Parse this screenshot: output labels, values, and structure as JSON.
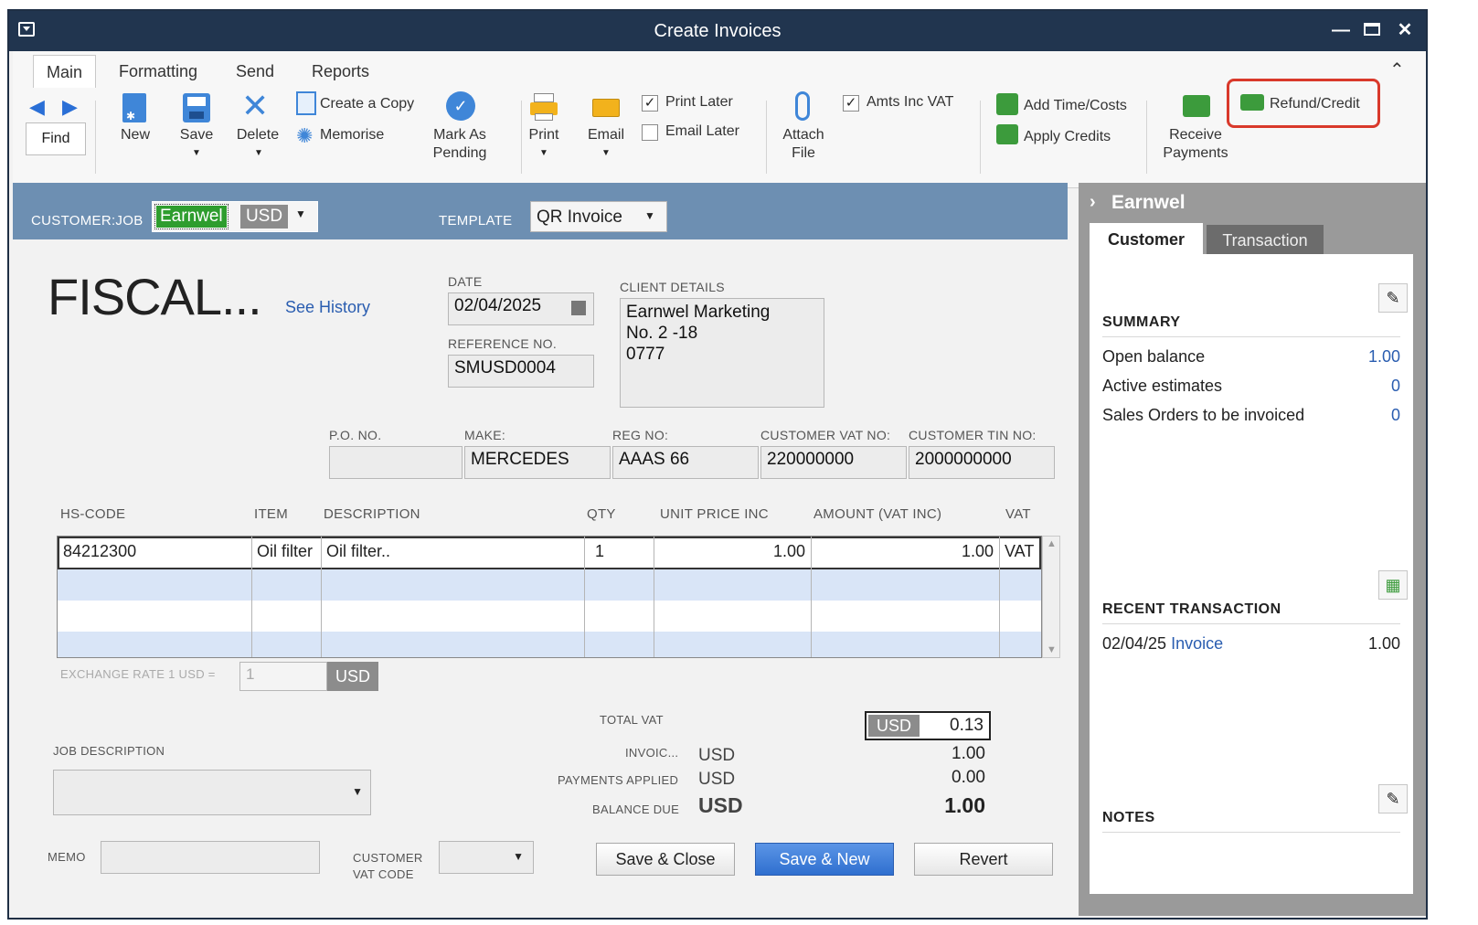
{
  "window": {
    "title": "Create Invoices"
  },
  "ribbon": {
    "tabs": [
      "Main",
      "Formatting",
      "Send",
      "Reports"
    ],
    "find_label": "Find",
    "new_label": "New",
    "save_label": "Save",
    "delete_label": "Delete",
    "create_copy_label": "Create a Copy",
    "memorise_label": "Memorise",
    "mark_as_pending_label": "Mark As\nPending",
    "print_label": "Print",
    "email_label": "Email",
    "print_later_label": "Print Later",
    "print_later_checked": true,
    "email_later_label": "Email Later",
    "email_later_checked": false,
    "attach_file_label": "Attach\nFile",
    "amts_inc_vat_label": "Amts Inc VAT",
    "amts_inc_vat_checked": true,
    "add_time_costs_label": "Add Time/Costs",
    "apply_credits_label": "Apply Credits",
    "receive_payments_label": "Receive\nPayments",
    "refund_credit_label": "Refund/Credit"
  },
  "header": {
    "customer_job_label": "CUSTOMER:JOB",
    "customer_job_value": "Earnwel",
    "currency": "USD",
    "template_label": "TEMPLATE",
    "template_value": "QR Invoice"
  },
  "form": {
    "title": "FISCAL...",
    "see_history": "See History",
    "date_label": "DATE",
    "date_value": "02/04/2025",
    "reference_label": "REFERENCE NO.",
    "reference_value": "SMUSD0004",
    "client_details_label": "CLIENT DETAILS",
    "client_details_lines": [
      "Earnwel Marketing",
      "No. 2 -18",
      "0777"
    ],
    "po_label": "P.O. NO.",
    "po_value": "",
    "make_label": "MAKE:",
    "make_value": "MERCEDES",
    "reg_label": "REG NO:",
    "reg_value": "AAAS 66",
    "vat_no_label": "CUSTOMER VAT NO:",
    "vat_no_value": "220000000",
    "tin_no_label": "CUSTOMER TIN NO:",
    "tin_no_value": "2000000000"
  },
  "lines": {
    "columns": [
      "HS-CODE",
      "ITEM",
      "DESCRIPTION",
      "QTY",
      "UNIT PRICE INC",
      "AMOUNT (VAT INC)",
      "VAT"
    ],
    "rows": [
      {
        "hs_code": "84212300",
        "item": "Oil filter",
        "description": "Oil filter..",
        "qty": "1",
        "unit_price": "1.00",
        "amount": "1.00",
        "vat": "VAT"
      }
    ]
  },
  "exchange": {
    "label": "EXCHANGE RATE 1 USD =",
    "value": "1",
    "currency": "USD"
  },
  "totals": {
    "total_vat_label": "TOTAL VAT",
    "total_vat_currency": "USD",
    "total_vat_value": "0.13",
    "invoice_label": "INVOIC...",
    "invoice_currency": "USD",
    "invoice_value": "1.00",
    "payments_label": "PAYMENTS APPLIED",
    "payments_currency": "USD",
    "payments_value": "0.00",
    "balance_label": "BALANCE DUE",
    "balance_currency": "USD",
    "balance_value": "1.00"
  },
  "footer": {
    "job_description_label": "JOB DESCRIPTION",
    "memo_label": "MEMO",
    "customer_vat_code_label_1": "CUSTOMER",
    "customer_vat_code_label_2": "VAT CODE",
    "save_close_label": "Save & Close",
    "save_new_label": "Save & New",
    "revert_label": "Revert"
  },
  "side_panel": {
    "name": "Earnwel",
    "tabs": [
      "Customer",
      "Transaction"
    ],
    "summary_heading": "SUMMARY",
    "summary": [
      {
        "label": "Open balance",
        "value": "1.00"
      },
      {
        "label": "Active estimates",
        "value": "0"
      },
      {
        "label": "Sales Orders to be invoiced",
        "value": "0"
      }
    ],
    "recent_heading": "RECENT TRANSACTION",
    "recent": {
      "date": "02/04/25",
      "type": "Invoice",
      "amount": "1.00"
    },
    "notes_heading": "NOTES"
  },
  "colors": {
    "title_bar": "#21354f",
    "strip": "#6d8fb2",
    "primary_button": "#3a78d8",
    "highlight": "#d9e5f7",
    "annotation": "#d9392b"
  }
}
